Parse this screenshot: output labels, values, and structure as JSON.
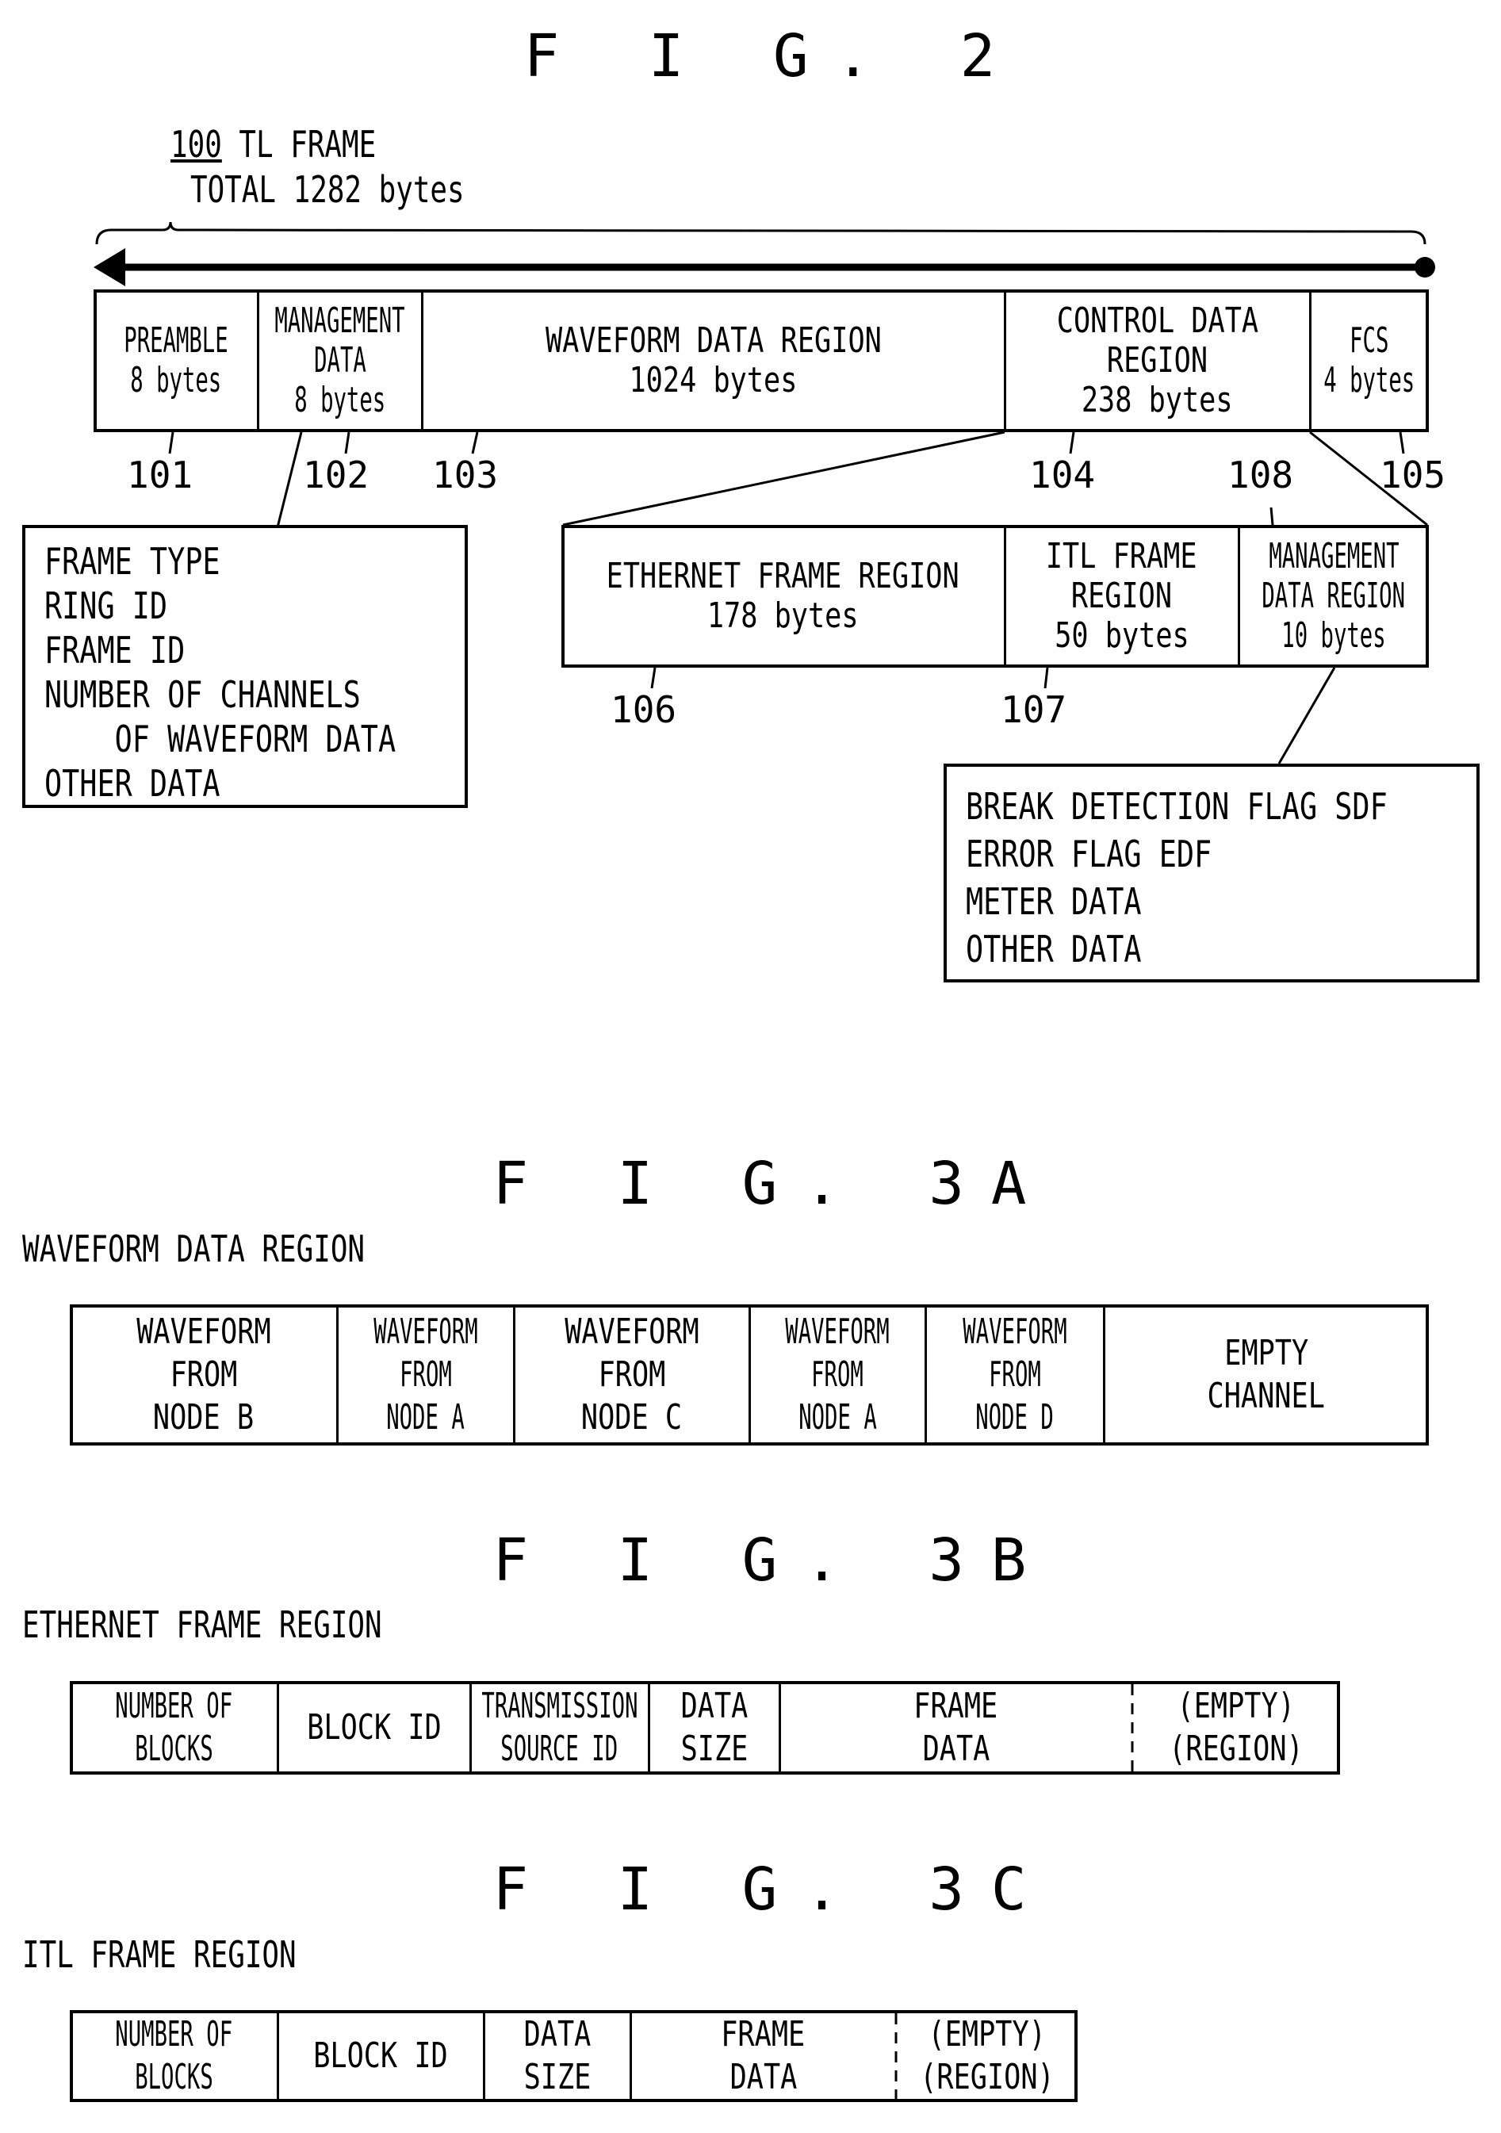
{
  "fig2": {
    "title": "F I G. 2",
    "frame_ref": "100",
    "frame_name": "TL FRAME",
    "total": "TOTAL 1282 bytes",
    "fields": [
      {
        "ref": "101",
        "lines": [
          "PREAMBLE",
          "8 bytes"
        ]
      },
      {
        "ref": "102",
        "lines": [
          "MANAGEMENT",
          "DATA",
          "8 bytes"
        ]
      },
      {
        "ref": "103",
        "lines": [
          "WAVEFORM DATA REGION",
          "1024 bytes"
        ]
      },
      {
        "ref": "104",
        "lines": [
          "CONTROL DATA",
          "REGION",
          "238 bytes"
        ]
      },
      {
        "ref": "105",
        "lines": [
          "FCS",
          "4 bytes"
        ]
      }
    ],
    "management_data_items": [
      "FRAME TYPE",
      "RING ID",
      "FRAME ID",
      "NUMBER OF CHANNELS",
      "    OF WAVEFORM DATA",
      "OTHER DATA"
    ],
    "control_subregions": [
      {
        "ref": "106",
        "lines": [
          "ETHERNET FRAME REGION",
          "178 bytes"
        ]
      },
      {
        "ref": "107",
        "lines": [
          "ITL FRAME",
          "REGION",
          "50 bytes"
        ]
      },
      {
        "ref": "108",
        "lines": [
          "MANAGEMENT",
          "DATA REGION",
          "10 bytes"
        ]
      }
    ],
    "management_region_items": [
      "BREAK DETECTION FLAG SDF",
      "ERROR FLAG EDF",
      "METER DATA",
      "OTHER DATA"
    ]
  },
  "fig3a": {
    "title": "F I G. 3A",
    "label": "WAVEFORM DATA REGION",
    "cells": [
      [
        "WAVEFORM",
        "FROM",
        "NODE B"
      ],
      [
        "WAVEFORM",
        "FROM",
        "NODE A"
      ],
      [
        "WAVEFORM",
        "FROM",
        "NODE C"
      ],
      [
        "WAVEFORM",
        "FROM",
        "NODE A"
      ],
      [
        "WAVEFORM",
        "FROM",
        "NODE D"
      ],
      [
        "EMPTY",
        "CHANNEL"
      ]
    ]
  },
  "fig3b": {
    "title": "F I G. 3B",
    "label": "ETHERNET FRAME REGION",
    "cells": [
      [
        "NUMBER OF",
        "BLOCKS"
      ],
      [
        "BLOCK ID"
      ],
      [
        "TRANSMISSION",
        "SOURCE ID"
      ],
      [
        "DATA",
        "SIZE"
      ],
      [
        "FRAME",
        "DATA"
      ],
      [
        "(EMPTY)",
        "(REGION)"
      ]
    ]
  },
  "fig3c": {
    "title": "F I G. 3C",
    "label": "ITL FRAME REGION",
    "cells": [
      [
        "NUMBER OF",
        "BLOCKS"
      ],
      [
        "BLOCK ID"
      ],
      [
        "DATA",
        "SIZE"
      ],
      [
        "FRAME",
        "DATA"
      ],
      [
        "(EMPTY)",
        "(REGION)"
      ]
    ]
  }
}
